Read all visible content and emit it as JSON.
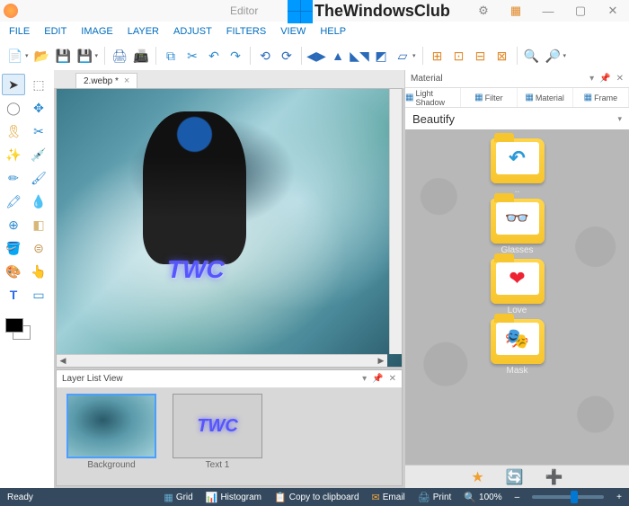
{
  "window": {
    "title": "Editor"
  },
  "brand": {
    "text": "TheWindowsClub"
  },
  "menu": [
    "FILE",
    "EDIT",
    "IMAGE",
    "LAYER",
    "ADJUST",
    "FILTERS",
    "VIEW",
    "HELP"
  ],
  "document": {
    "tab_label": "2.webp *",
    "overlay_text": "TWC"
  },
  "layer_panel": {
    "title": "Layer List View",
    "layers": [
      {
        "name": "Background"
      },
      {
        "name": "Text 1",
        "text": "TWC"
      }
    ]
  },
  "material_panel": {
    "title": "Material",
    "tabs": [
      "Light Shadow",
      "Filter",
      "Material",
      "Frame"
    ],
    "section": "Beautify",
    "folders": [
      {
        "label": "..",
        "icon": "↩"
      },
      {
        "label": "Glasses",
        "icon": "👓"
      },
      {
        "label": "Love",
        "icon": "❤"
      },
      {
        "label": "Mask",
        "icon": "🎭"
      }
    ]
  },
  "statusbar": {
    "ready": "Ready",
    "grid": "Grid",
    "histogram": "Histogram",
    "copy": "Copy to clipboard",
    "email": "Email",
    "print": "Print",
    "zoom": "100%"
  }
}
